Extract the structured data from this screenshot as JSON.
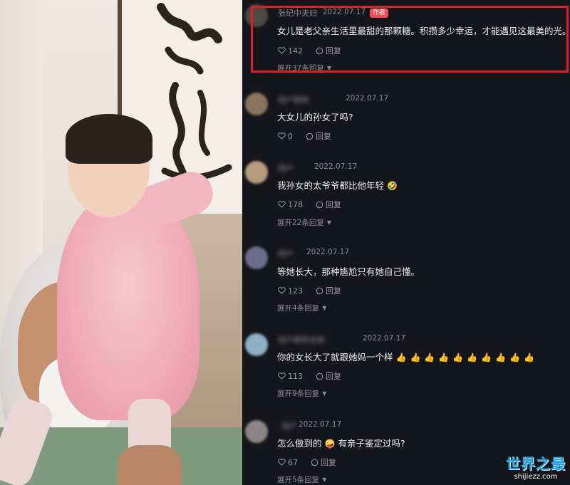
{
  "photo": {
    "calligraphy_chars": [
      "忠",
      "慈"
    ]
  },
  "comments": [
    {
      "name": "张纪中夫妇",
      "date": "2022.07.17",
      "badge": "作者",
      "text": "女儿是老父亲生活里最甜的那颗糖。积攒多少幸运，才能遇见这最美的光。",
      "likes": "142",
      "reply": "回复",
      "expand": "展开37条回复",
      "avatar_color": "#4d4a47"
    },
    {
      "name": "用户昵称",
      "date": "2022.07.17",
      "text": "大女儿的孙女了吗?",
      "likes": "0",
      "reply": "回复",
      "expand": "",
      "avatar_color": "#8a7460"
    },
    {
      "name": "用户",
      "date": "2022.07.17",
      "text": "我孙女的太爷爷都比他年轻",
      "emoji": "🤣",
      "likes": "178",
      "reply": "回复",
      "expand": "展开22条回复",
      "avatar_color": "#b89a7d"
    },
    {
      "name": "用户",
      "date": "2022.07.17",
      "text": "等她长大，那种尴尬只有她自己懂。",
      "likes": "123",
      "reply": "回复",
      "expand": "展开4条回复",
      "avatar_color": "#6c6d8c"
    },
    {
      "name": "用户昵称名称",
      "date": "2022.07.17",
      "text": "你的女长大了就跟她妈一个样",
      "emoji_repeat": "👍👍👍👍👍👍👍👍👍👍",
      "likes": "113",
      "reply": "回复",
      "expand": "展开9条回复",
      "avatar_color": "#8fb0c4"
    },
    {
      "name": "用户",
      "date": "2022.07.17",
      "text": "怎么做到的",
      "emoji": "🤪",
      "text2": "有亲子鉴定过吗?",
      "likes": "67",
      "reply": "回复",
      "expand": "展开5条回复",
      "avatar_color": "#8d8585"
    }
  ],
  "watermark": {
    "main": "世界之最",
    "sub": "shijiezz.com"
  },
  "colors": {
    "panel_bg": "#15161b",
    "highlight": "#e11f22",
    "badge": "#f34d53",
    "watermark": "#1aa0e8"
  }
}
